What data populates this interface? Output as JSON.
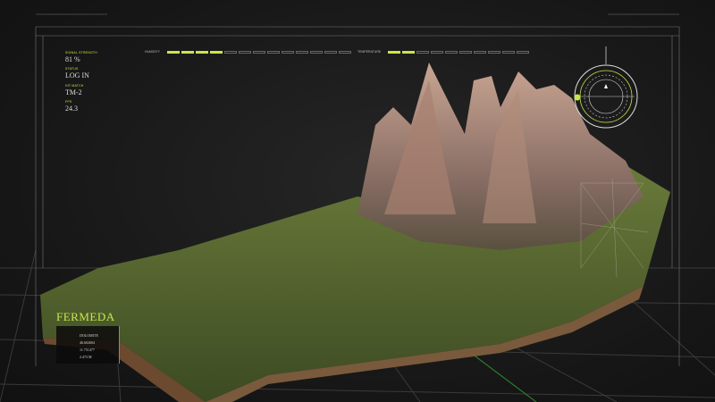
{
  "left_panel": [
    {
      "label": "SIGNAL STRENGTH",
      "value": "81 %"
    },
    {
      "label": "STATUS",
      "value": "LOG IN"
    },
    {
      "label": "HIT MATCH",
      "value": "TM-2"
    },
    {
      "label": "FPS",
      "value": "24.3"
    }
  ],
  "humidity": {
    "label": "HUMIDITY",
    "segments_total": 13,
    "segments_on": 4
  },
  "temperature": {
    "label": "TEMPERATURE",
    "segments_total": 10,
    "segments_on": 2
  },
  "location": {
    "name": "FERMEDA",
    "type": "DOLOMITE",
    "lat": "46.602604",
    "lon": "11.751477",
    "altitude": "2.473 M"
  },
  "colors": {
    "accent": "#c8e64a",
    "background": "#151515"
  }
}
